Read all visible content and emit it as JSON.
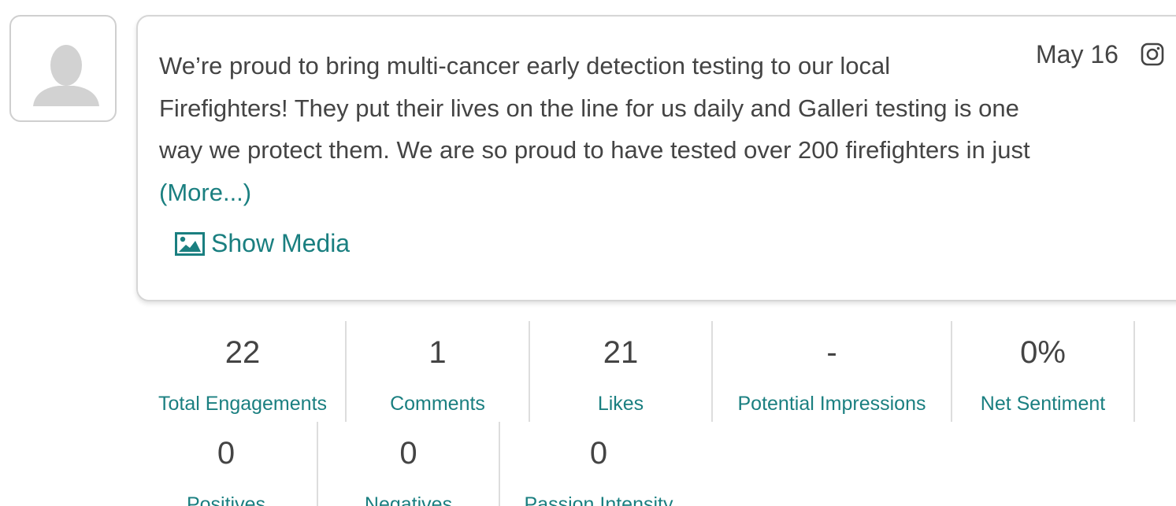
{
  "post": {
    "date": "May 16",
    "source_icon": "instagram-icon",
    "text_lines": [
      "We’re proud to bring multi-cancer early detection testing to our local",
      "Firefighters! They put their lives on the line for us daily and Galleri testing is one",
      "way we protect them. We are so proud to have tested over 200 firefighters in just"
    ],
    "more_label": "(More...)",
    "show_media_label": "Show Media"
  },
  "colors": {
    "accent": "#1a7f80",
    "text": "#444444",
    "border": "#d6d6d6"
  },
  "metrics_row1": [
    {
      "value": "22",
      "label": "Total Engagements"
    },
    {
      "value": "1",
      "label": "Comments"
    },
    {
      "value": "21",
      "label": "Likes"
    },
    {
      "value": "-",
      "label": "Potential Impressions"
    },
    {
      "value": "0%",
      "label": "Net Sentiment"
    }
  ],
  "metrics_row2": [
    {
      "value": "0",
      "label": "Positives"
    },
    {
      "value": "0",
      "label": "Negatives"
    },
    {
      "value": "0",
      "label": "Passion Intensity"
    }
  ]
}
